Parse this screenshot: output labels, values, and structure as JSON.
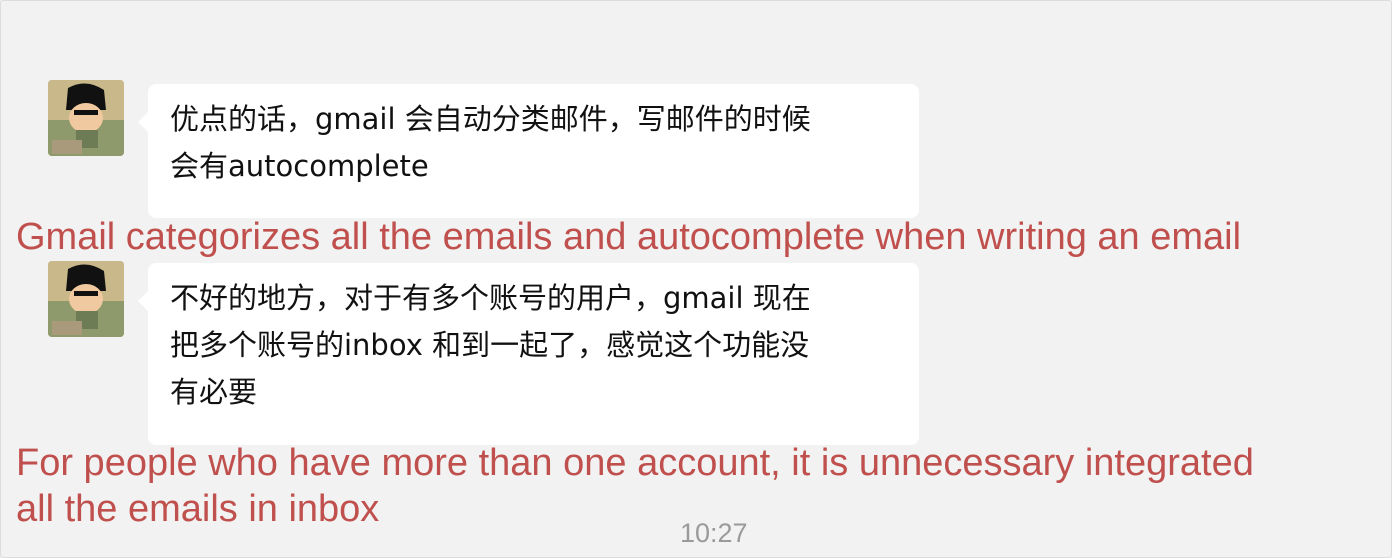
{
  "messages": [
    {
      "lines": [
        "优点的话，gmail 会自动分类邮件，写邮件的时候",
        "会有autocomplete"
      ],
      "annotation": [
        "Gmail categorizes all the emails and autocomplete when writing an email"
      ]
    },
    {
      "lines": [
        "不好的地方，对于有多个账号的用户，gmail 现在",
        "把多个账号的inbox 和到一起了，感觉这个功能没",
        "有必要"
      ],
      "annotation": [
        "For people who have more than one account, it is unnecessary integrated",
        "all the emails in inbox"
      ]
    }
  ],
  "timestamp": "10:27",
  "colors": {
    "annotation": "#c0504d",
    "background": "#f2f2f2",
    "bubble": "#ffffff"
  }
}
